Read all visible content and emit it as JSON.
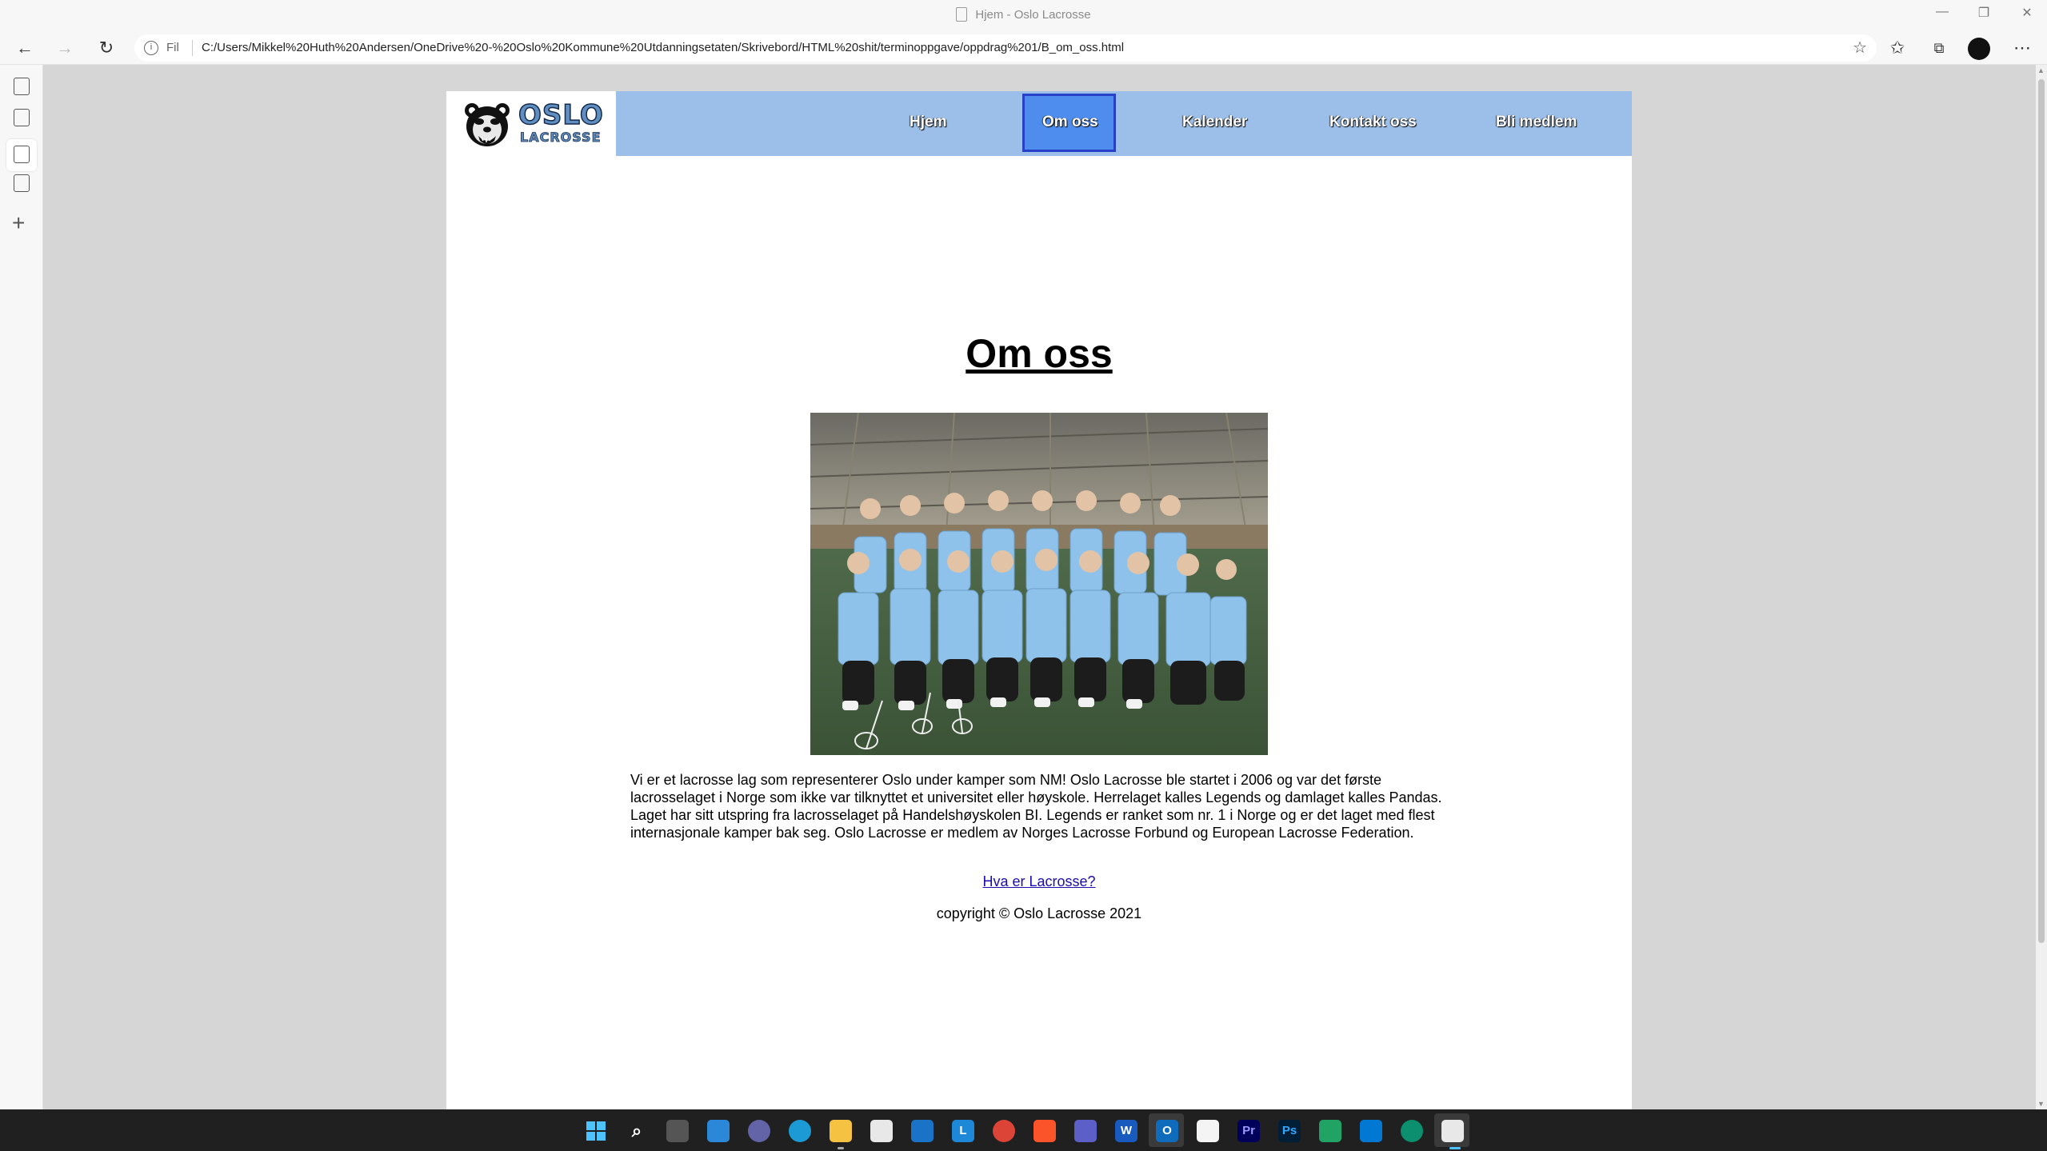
{
  "window": {
    "title": "Hjem - Oslo Lacrosse",
    "controls": [
      "minimize",
      "restore",
      "close"
    ]
  },
  "addressbar": {
    "scheme_label": "Fil",
    "url": "C:/Users/Mikkel%20Huth%20Andersen/OneDrive%20-%20Oslo%20Kommune%20Utdanningsetaten/Skrivebord/HTML%20shit/terminoppgave/oppdrag%201/B_om_oss.html"
  },
  "site": {
    "logo": {
      "line1": "OSLO",
      "line2": "LACROSSE"
    },
    "nav": [
      {
        "label": "Hjem",
        "active": false
      },
      {
        "label": "Om oss",
        "active": true
      },
      {
        "label": "Kalender",
        "active": false
      },
      {
        "label": "Kontakt oss",
        "active": false
      },
      {
        "label": "Bli medlem",
        "active": false
      }
    ],
    "heading": "Om oss",
    "photo_alt": "team-photo",
    "body": "Vi er et lacrosse lag som representerer Oslo under kamper som NM! Oslo Lacrosse ble startet i 2006 og var det første lacrosselaget i Norge som ikke var tilknyttet et universitet eller høyskole. Herrelaget kalles Legends og damlaget kalles Pandas. Laget har sitt utspring fra lacrosselaget på Handelshøyskolen BI. Legends er ranket som nr. 1 i Norge og er det laget med flest internasjonale kamper bak seg. Oslo Lacrosse er medlem av Norges Lacrosse Forbund og European Lacrosse Federation.",
    "link": "Hva er Lacrosse?",
    "copyright": "copyright © Oslo Lacrosse 2021"
  },
  "colors": {
    "nav_bg": "#9bbfe8",
    "nav_active_bg": "#4e8dee",
    "nav_active_border": "#2840c8",
    "jersey": "#8fc2ea",
    "link": "#1a0dab"
  },
  "taskbar": {
    "icons": [
      "windows-start-icon",
      "search-icon",
      "task-view-icon",
      "widgets-icon",
      "chat-icon",
      "edge-icon",
      "file-explorer-icon",
      "store-icon",
      "mail-icon",
      "app-l-icon",
      "chrome-icon",
      "brave-icon",
      "teams-icon",
      "word-icon",
      "outlook-icon",
      "notepad-icon",
      "premiere-icon",
      "photoshop-icon",
      "excel-icon",
      "vscode-icon",
      "edge-dev-icon",
      "active-file-icon"
    ],
    "labels": {
      "app-l-icon": "L",
      "word-icon": "W",
      "outlook-icon": "O",
      "premiere-icon": "Pr",
      "photoshop-icon": "Ps"
    }
  }
}
